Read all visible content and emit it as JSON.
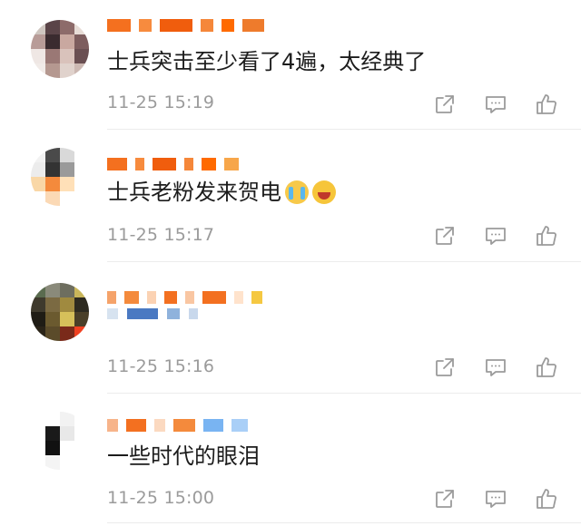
{
  "comments": [
    {
      "text": "士兵突击至少看了4遍，太经典了",
      "time": "11-25 15:19",
      "avatar_colors": [
        "#cfc6c0",
        "#5a4448",
        "#8d6b6a",
        "#e7dcd6",
        "#b89c98",
        "#3a2b2f",
        "#c9a8a0",
        "#7d5d5e",
        "#efe7e4",
        "#9a7875",
        "#d9c2bb",
        "#6a4f52",
        "#f1ebe8",
        "#b59890",
        "#e0d2cc",
        "#ccb8b2"
      ],
      "name_colors": [
        "#f4701f",
        "#f78b3e",
        "#f05d0d",
        "#f5873a",
        "#ff6a00",
        "#ee7b2c"
      ]
    },
    {
      "text": "士兵老粉发来贺电",
      "emoji": [
        "crying-face-emoji",
        "laughing-face-emoji"
      ],
      "time": "11-25 15:17",
      "avatar_colors": [
        "#f2f2f2",
        "#4a4a4a",
        "#d9d9d9",
        "#ffffff",
        "#ececec",
        "#333333",
        "#9a9a9a",
        "#ffffff",
        "#f9d7a6",
        "#f48a3c",
        "#ffe0b8",
        "#ffffff",
        "#ffffff",
        "#fbd9b5",
        "#ffffff",
        "#ffffff"
      ],
      "name_colors": [
        "#f4701f",
        "#f78b3e",
        "#f05d0d",
        "#f5873a",
        "#ff6a00",
        "#f7a64a"
      ]
    },
    {
      "time": "11-25 15:16",
      "avatar_colors": [
        "#5a6b4f",
        "#8a8a7a",
        "#6e6e5f",
        "#c9b65a",
        "#3f3a2d",
        "#7b6a42",
        "#a08a3f",
        "#2d2a20",
        "#1f1c15",
        "#6b5a2f",
        "#d6c05a",
        "#4a3f28",
        "#2a2418",
        "#5b4b2a",
        "#7a2a1a",
        "#f04020"
      ],
      "name_colors": [
        "#f5a36a",
        "#f48a3c",
        "#fbd2b3",
        "#f37020",
        "#f9c6a2",
        "#f37020",
        "#ffe3cc",
        "#f5c842"
      ],
      "text_blur_colors": [
        "#d7e3f0",
        "#4a79c2",
        "#8fb2dc",
        "#c8d8ec"
      ]
    },
    {
      "text": "一些时代的眼泪",
      "time": "11-25 15:00",
      "avatar_colors": [
        "#ffffff",
        "#ffffff",
        "#f2f2f2",
        "#ffffff",
        "#ffffff",
        "#1a1a1a",
        "#e8e8e8",
        "#ffffff",
        "#ffffff",
        "#111111",
        "#ffffff",
        "#ffffff",
        "#ffffff",
        "#f4f4f4",
        "#ffffff",
        "#ffffff"
      ],
      "name_colors": [
        "#f7b48a",
        "#f37020",
        "#fbd9c0",
        "#f48a3c",
        "#79b4f2",
        "#a9cff7"
      ]
    }
  ],
  "icons": {
    "share": "share-icon",
    "reply": "comment-icon",
    "like": "thumbs-up-icon"
  },
  "colors": {
    "text": "#1c1c1c",
    "timestamp": "#9b9b9b",
    "icon": "#9b9b9b",
    "divider": "#ececec"
  }
}
